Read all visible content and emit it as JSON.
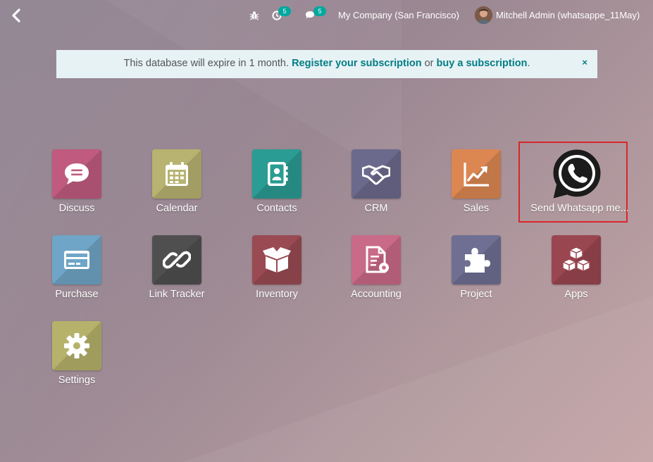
{
  "topbar": {
    "back_icon": "chevron-left-icon",
    "debug_icon": "bug-icon",
    "activity_count": "5",
    "messages_count": "5",
    "company": "My Company (San Francisco)",
    "user_name": "Mitchell Admin (whatsappe_11May)"
  },
  "banner": {
    "text_prefix": "This database will expire in 1 month.",
    "register_link": "Register your subscription",
    "or": "or",
    "buy_link": "buy a subscription",
    "period": ".",
    "close": "×"
  },
  "apps": [
    {
      "label": "Discuss",
      "color": "#c05b7f",
      "icon": "chat-bubble-icon"
    },
    {
      "label": "Calendar",
      "color": "#b8b370",
      "icon": "calendar-icon"
    },
    {
      "label": "Contacts",
      "color": "#2b9c93",
      "icon": "address-book-icon"
    },
    {
      "label": "CRM",
      "color": "#6c6a8c",
      "icon": "handshake-icon"
    },
    {
      "label": "Sales",
      "color": "#dc8752",
      "icon": "trend-chart-icon"
    },
    {
      "label": "Send Whatsapp me...",
      "color": "#ffffff",
      "icon": "whatsapp-icon"
    },
    {
      "label": "Purchase",
      "color": "#6fa5c6",
      "icon": "credit-card-icon"
    },
    {
      "label": "Link Tracker",
      "color": "#4f4f4f",
      "icon": "link-icon"
    },
    {
      "label": "Inventory",
      "color": "#9a4a52",
      "icon": "box-icon"
    },
    {
      "label": "Accounting",
      "color": "#c96a88",
      "icon": "invoice-gear-icon"
    },
    {
      "label": "Project",
      "color": "#6e6f93",
      "icon": "puzzle-icon"
    },
    {
      "label": "Apps",
      "color": "#9a4650",
      "icon": "cubes-icon"
    },
    {
      "label": "Settings",
      "color": "#b6b26b",
      "icon": "gear-icon"
    }
  ]
}
